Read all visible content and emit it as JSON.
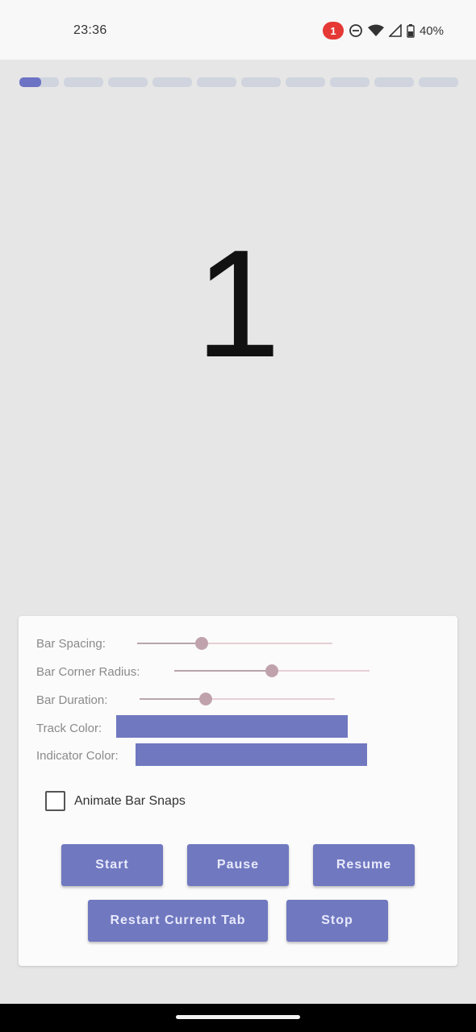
{
  "status_bar": {
    "time": "23:36",
    "notification_count": "1",
    "battery": "40%",
    "icons": [
      "dnd-icon",
      "wifi-icon",
      "signal-icon",
      "battery-icon"
    ]
  },
  "progress": {
    "segment_count": 10,
    "current_index": 0,
    "current_fill": 0.55,
    "colors": {
      "track": "#cfd4de",
      "indicator": "#6c73c4"
    }
  },
  "content": {
    "number": "1"
  },
  "settings": {
    "bar_spacing": {
      "label": "Bar Spacing:",
      "value": 0.33
    },
    "bar_corner_radius": {
      "label": "Bar Corner Radius:",
      "value": 0.5
    },
    "bar_duration": {
      "label": "Bar Duration:",
      "value": 0.34
    },
    "track_color": {
      "label": "Track Color:",
      "color": "#7078c0"
    },
    "indicator_color": {
      "label": "Indicator Color:",
      "color": "#7078c0"
    },
    "animate_snaps": {
      "label": "Animate Bar Snaps",
      "checked": false
    }
  },
  "buttons": {
    "start": "Start",
    "pause": "Pause",
    "resume": "Resume",
    "restart": "Restart Current Tab",
    "stop": "Stop"
  }
}
